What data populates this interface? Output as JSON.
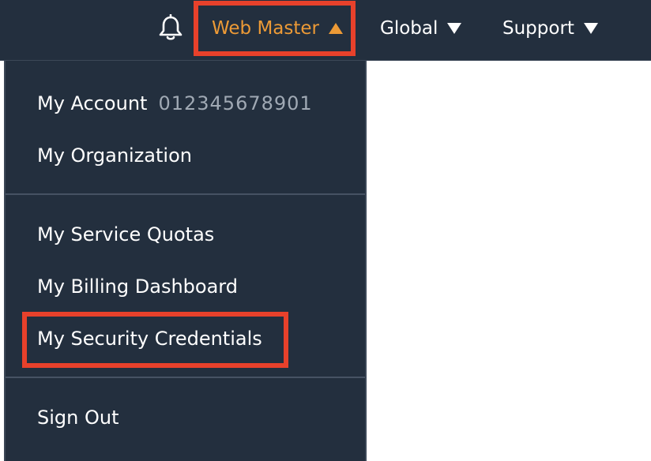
{
  "topbar": {
    "bell_icon": "bell-icon",
    "user_menu_label": "Web Master",
    "region_label": "Global",
    "support_label": "Support",
    "accent_color": "#ec9a36",
    "background_color": "#232f3e"
  },
  "dropdown": {
    "account_label": "My Account",
    "account_id": "012345678901",
    "organization_label": "My Organization",
    "service_quotas_label": "My Service Quotas",
    "billing_label": "My Billing Dashboard",
    "security_credentials_label": "My Security Credentials",
    "sign_out_label": "Sign Out"
  },
  "annotation": {
    "highlight_color": "#e8412b"
  }
}
